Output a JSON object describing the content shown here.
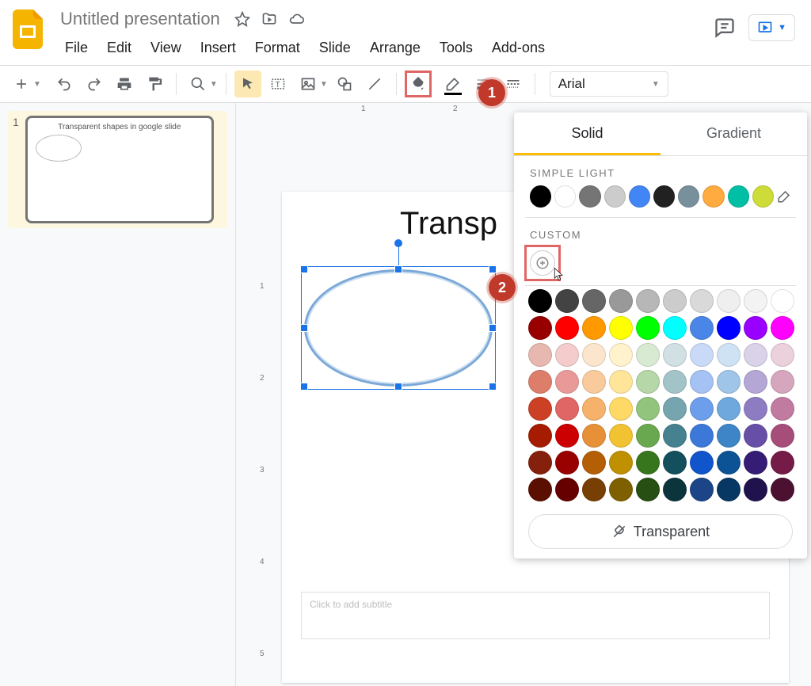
{
  "doc": {
    "title": "Untitled presentation"
  },
  "menu": {
    "file": "File",
    "edit": "Edit",
    "view": "View",
    "insert": "Insert",
    "format": "Format",
    "slide": "Slide",
    "arrange": "Arrange",
    "tools": "Tools",
    "addons": "Add-ons"
  },
  "toolbar": {
    "font": "Arial"
  },
  "ruler": {
    "h": [
      "1",
      "2"
    ],
    "v": [
      "1",
      "2",
      "3",
      "4",
      "5"
    ]
  },
  "slide_panel": {
    "num": "1",
    "thumb_title": "Transparent shapes in google slide"
  },
  "slide": {
    "heading": "Transp",
    "subtitle_placeholder": "Click to add subtitle"
  },
  "popover": {
    "tab_solid": "Solid",
    "tab_gradient": "Gradient",
    "simple_light": "SIMPLE LIGHT",
    "custom": "CUSTOM",
    "transparent": "Transparent",
    "theme_colors": [
      "#000000",
      "#ffffff",
      "#757575",
      "#cccccc",
      "#4285f4",
      "#212121",
      "#78909c",
      "#ffab40",
      "#00bfa5",
      "#cddc39"
    ],
    "grid_colors": [
      "#000000",
      "#434343",
      "#666666",
      "#999999",
      "#b7b7b7",
      "#cccccc",
      "#d9d9d9",
      "#efefef",
      "#f3f3f3",
      "#ffffff",
      "#980000",
      "#ff0000",
      "#ff9900",
      "#ffff00",
      "#00ff00",
      "#00ffff",
      "#4a86e8",
      "#0000ff",
      "#9900ff",
      "#ff00ff",
      "#e6b8af",
      "#f4cccc",
      "#fce5cd",
      "#fff2cc",
      "#d9ead3",
      "#d0e0e3",
      "#c9daf8",
      "#cfe2f3",
      "#d9d2e9",
      "#ead1dc",
      "#dd7e6b",
      "#ea9999",
      "#f9cb9c",
      "#ffe599",
      "#b6d7a8",
      "#a2c4c9",
      "#a4c2f4",
      "#9fc5e8",
      "#b4a7d6",
      "#d5a6bd",
      "#cc4125",
      "#e06666",
      "#f6b26b",
      "#ffd966",
      "#93c47d",
      "#76a5af",
      "#6d9eeb",
      "#6fa8dc",
      "#8e7cc3",
      "#c27ba0",
      "#a61c00",
      "#cc0000",
      "#e69138",
      "#f1c232",
      "#6aa84f",
      "#45818e",
      "#3c78d8",
      "#3d85c6",
      "#674ea7",
      "#a64d79",
      "#85200c",
      "#990000",
      "#b45f06",
      "#bf9000",
      "#38761d",
      "#134f5c",
      "#1155cc",
      "#0b5394",
      "#351c75",
      "#741b47",
      "#5b0f00",
      "#660000",
      "#783f04",
      "#7f6000",
      "#274e13",
      "#0c343d",
      "#1c4587",
      "#073763",
      "#20124d",
      "#4c1130"
    ]
  },
  "callouts": {
    "one": "1",
    "two": "2"
  }
}
